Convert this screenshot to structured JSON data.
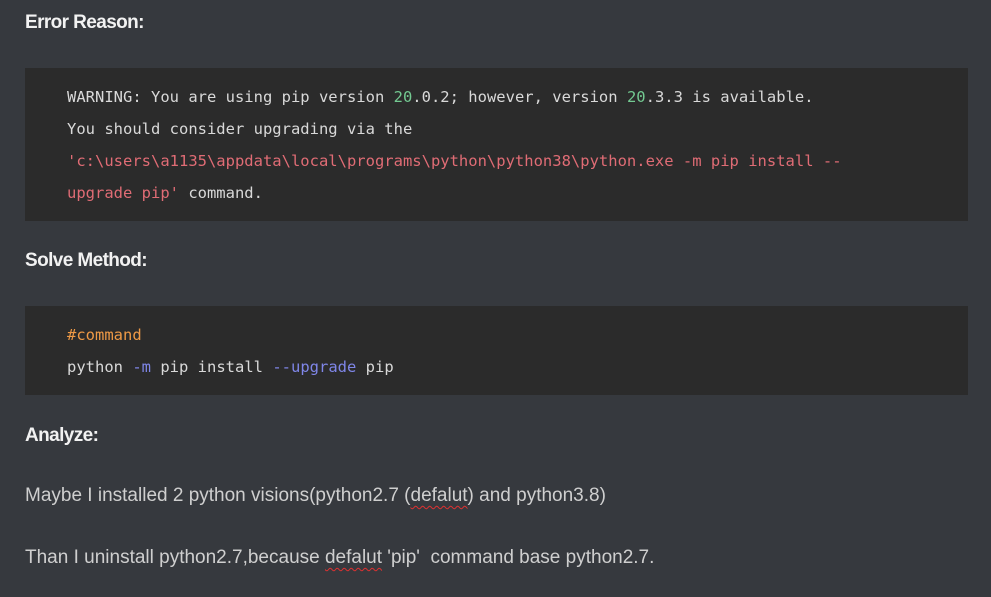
{
  "error_reason": {
    "heading": "Error Reason:",
    "line1": {
      "a": "WARNING: You are using pip version ",
      "n1": "20",
      "b": ".0.2; however, version ",
      "n2": "20",
      "c": ".3.3 is available."
    },
    "line2": "You should consider upgrading via the",
    "line3": "'c:\\users\\a1135\\appdata\\local\\programs\\python\\python38\\python.exe -m pip install --",
    "line4": {
      "str": "upgrade pip'",
      "rest": " command."
    }
  },
  "solve_method": {
    "heading": "Solve Method:",
    "comment": "#command",
    "cmd": {
      "a": "python ",
      "flag1": "-m",
      "b": " pip install ",
      "flag2": "--upgrade",
      "c": " pip"
    }
  },
  "analyze": {
    "heading": "Analyze:",
    "p1": {
      "a": "Maybe I installed 2 python visions(python2.7 (",
      "typo": "defalut",
      "b": ") and python3.8)"
    },
    "p2": {
      "a": "Than I uninstall python2.7,because ",
      "typo": "defalut",
      "b": " 'pip'  command base python2.7."
    }
  },
  "colors": {
    "background": "#36393e",
    "code_background": "#2b2b2b",
    "number": "#73c991",
    "string": "#e06c75",
    "comment": "#ef9a46",
    "flag": "#7f86e8"
  }
}
